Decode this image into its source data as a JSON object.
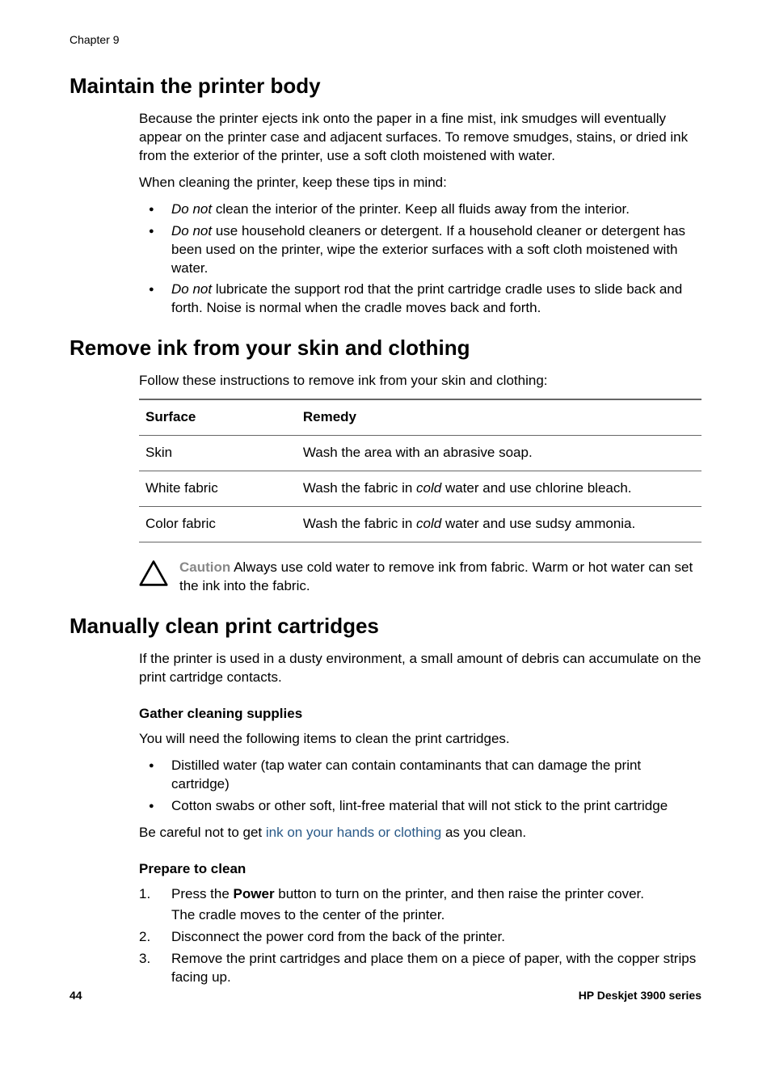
{
  "chapter": "Chapter 9",
  "section1": {
    "title": "Maintain the printer body",
    "p1": "Because the printer ejects ink onto the paper in a fine mist, ink smudges will eventually appear on the printer case and adjacent surfaces. To remove smudges, stains, or dried ink from the exterior of the printer, use a soft cloth moistened with water.",
    "p2": "When cleaning the printer, keep these tips in mind:",
    "bullets": [
      {
        "pre": "Do not",
        "post": " clean the interior of the printer. Keep all fluids away from the interior."
      },
      {
        "pre": "Do not",
        "post": " use household cleaners or detergent. If a household cleaner or detergent has been used on the printer, wipe the exterior surfaces with a soft cloth moistened with water."
      },
      {
        "pre": "Do not",
        "post": " lubricate the support rod that the print cartridge cradle uses to slide back and forth. Noise is normal when the cradle moves back and forth."
      }
    ]
  },
  "section2": {
    "title": "Remove ink from your skin and clothing",
    "p1": "Follow these instructions to remove ink from your skin and clothing:",
    "header_surface": "Surface",
    "header_remedy": "Remedy",
    "rows": [
      {
        "surface": "Skin",
        "remedy_pre": "Wash the area with an abrasive soap.",
        "italic": "",
        "remedy_post": ""
      },
      {
        "surface": "White fabric",
        "remedy_pre": "Wash the fabric in ",
        "italic": "cold",
        "remedy_post": " water and use chlorine bleach."
      },
      {
        "surface": "Color fabric",
        "remedy_pre": "Wash the fabric in ",
        "italic": "cold",
        "remedy_post": " water and use sudsy ammonia."
      }
    ],
    "caution_label": "Caution",
    "caution_text": "   Always use cold water to remove ink from fabric. Warm or hot water can set the ink into the fabric."
  },
  "section3": {
    "title": "Manually clean print cartridges",
    "p1": "If the printer is used in a dusty environment, a small amount of debris can accumulate on the print cartridge contacts.",
    "sub1_title": "Gather cleaning supplies",
    "sub1_p1": "You will need the following items to clean the print cartridges.",
    "sub1_bullets": [
      "Distilled water (tap water can contain contaminants that can damage the print cartridge)",
      "Cotton swabs or other soft, lint-free material that will not stick to the print cartridge"
    ],
    "sub1_p2_pre": "Be careful not to get ",
    "sub1_p2_link": "ink on your hands or clothing",
    "sub1_p2_post": " as you clean.",
    "sub2_title": "Prepare to clean",
    "steps": [
      {
        "pre": "Press the ",
        "bold": "Power",
        "post": " button to turn on the printer, and then raise the printer cover.",
        "sub": "The cradle moves to the center of the printer."
      },
      {
        "pre": "Disconnect the power cord from the back of the printer.",
        "bold": "",
        "post": "",
        "sub": ""
      },
      {
        "pre": "Remove the print cartridges and place them on a piece of paper, with the copper strips facing up.",
        "bold": "",
        "post": "",
        "sub": ""
      }
    ]
  },
  "footer": {
    "page": "44",
    "product": "HP Deskjet 3900 series"
  }
}
